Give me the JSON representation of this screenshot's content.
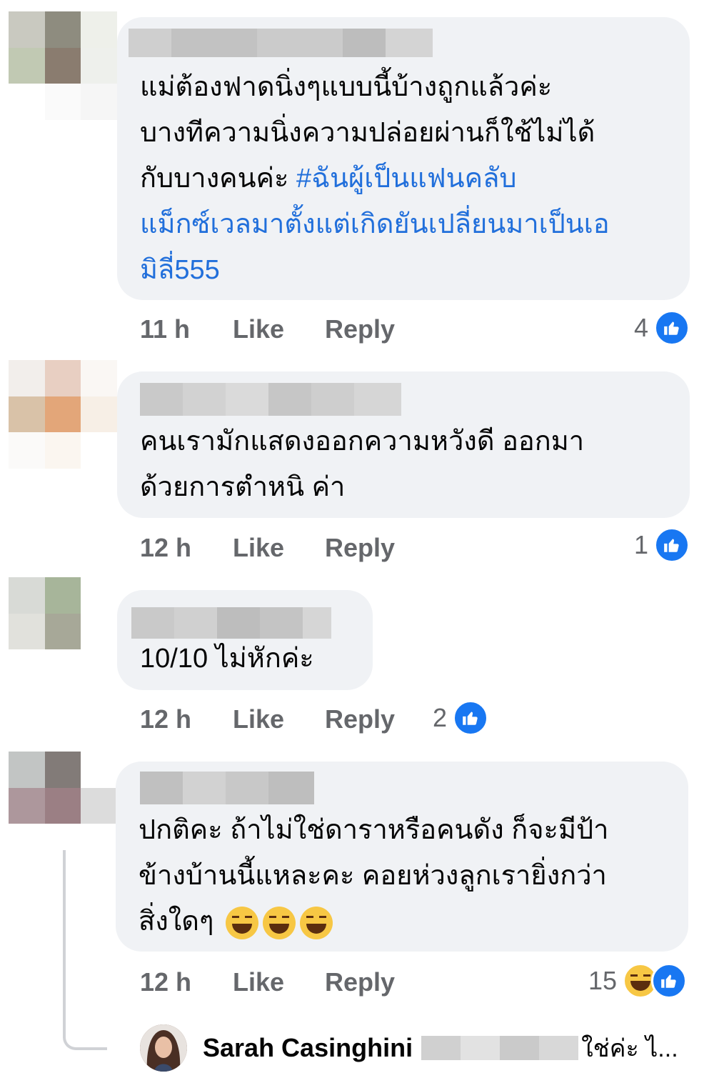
{
  "comments": [
    {
      "text": "แม่ต้องฟาดนิ่งๆแบบนี้บ้างถูกแล้วค่ะ\nบางทีความนิ่งความปล่อยผ่านก็ใช้ไม่ได้\nกับบางคนค่ะ ",
      "hashtag": "#ฉันผู้เป็นแฟนคลับ\nแม็กซ์เวลมาตั้งแต่เกิดยันเปลี่ยนมาเป็นเอ\nมิลี่555",
      "time": "11 h",
      "like_label": "Like",
      "reply_label": "Reply",
      "reaction_count": "4"
    },
    {
      "text": "คนเรามักแสดงออกความหวังดี ออกมา\nด้วยการตำหนิ ค่า",
      "time": "12 h",
      "like_label": "Like",
      "reply_label": "Reply",
      "reaction_count": "1"
    },
    {
      "text": "10/10 ไม่หักค่ะ",
      "time": "12 h",
      "like_label": "Like",
      "reply_label": "Reply",
      "reaction_count": "2"
    },
    {
      "text": "ปกติคะ ถ้าไม่ใช่ดาราหรือคนดัง ก็จะมีป้า\nข้างบ้านนี้แหละคะ คอยห่วงลูกเรายิ่งกว่า\nสิ่งใดๆ ",
      "time": "12 h",
      "like_label": "Like",
      "reply_label": "Reply",
      "reaction_count": "15"
    }
  ],
  "reply": {
    "author": "Sarah Casinghini",
    "text": "ใช่ค่ะ ไ..."
  },
  "colors": {
    "like_blue": "#1877f2",
    "hashtag_blue": "#216fdb",
    "bubble": "#f0f2f5",
    "meta_gray": "#65676b"
  }
}
